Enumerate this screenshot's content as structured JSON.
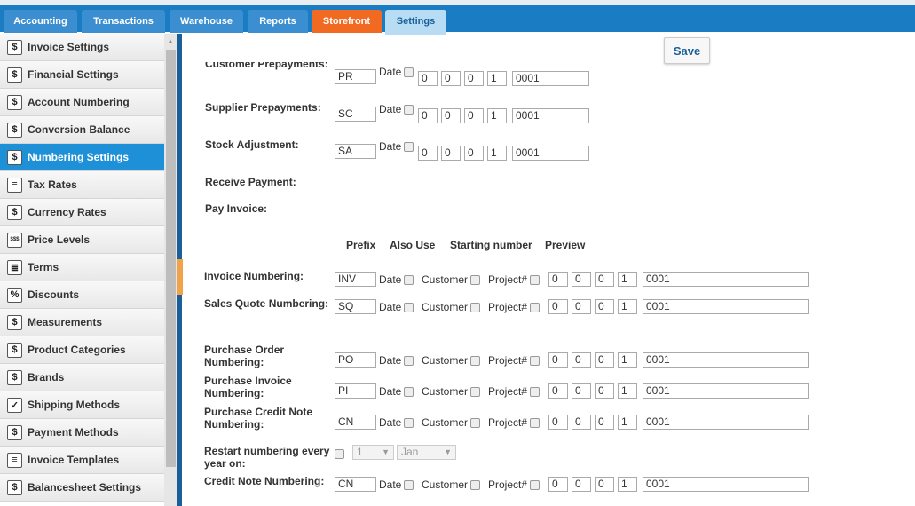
{
  "tabs": [
    "Accounting",
    "Transactions",
    "Warehouse",
    "Reports",
    "Storefront",
    "Settings"
  ],
  "sidebar": {
    "items": [
      {
        "label": "Invoice Settings",
        "icon": "$"
      },
      {
        "label": "Financial Settings",
        "icon": "$"
      },
      {
        "label": "Account Numbering",
        "icon": "$"
      },
      {
        "label": "Conversion Balance",
        "icon": "$"
      },
      {
        "label": "Numbering Settings",
        "icon": "$"
      },
      {
        "label": "Tax Rates",
        "icon": "≡"
      },
      {
        "label": "Currency Rates",
        "icon": "$"
      },
      {
        "label": "Price Levels",
        "icon": "$$$"
      },
      {
        "label": "Terms",
        "icon": "≣"
      },
      {
        "label": "Discounts",
        "icon": "%"
      },
      {
        "label": "Measurements",
        "icon": "$"
      },
      {
        "label": "Product Categories",
        "icon": "$"
      },
      {
        "label": "Brands",
        "icon": "$"
      },
      {
        "label": "Shipping Methods",
        "icon": "✓"
      },
      {
        "label": "Payment Methods",
        "icon": "$"
      },
      {
        "label": "Invoice Templates",
        "icon": "≡"
      },
      {
        "label": "Balancesheet Settings",
        "icon": "$"
      }
    ]
  },
  "save_label": "Save",
  "prepay_rows": [
    {
      "label": "Customer Prepayments:",
      "prefix": "PR",
      "date_label": "Date",
      "d": [
        "0",
        "0",
        "0",
        "1"
      ],
      "preview": "0001"
    },
    {
      "label": "Supplier Prepayments:",
      "prefix": "SC",
      "date_label": "Date",
      "d": [
        "0",
        "0",
        "0",
        "1"
      ],
      "preview": "0001"
    },
    {
      "label": "Stock Adjustment:",
      "prefix": "SA",
      "date_label": "Date",
      "d": [
        "0",
        "0",
        "0",
        "1"
      ],
      "preview": "0001"
    }
  ],
  "receive_payment": "Receive Payment:",
  "pay_invoice": "Pay Invoice:",
  "headers": {
    "prefix": "Prefix",
    "also_use": "Also Use",
    "starting": "Starting number",
    "preview": "Preview"
  },
  "num_rows": [
    {
      "label": "Invoice Numbering:",
      "prefix": "INV",
      "d": [
        "0",
        "0",
        "0",
        "1"
      ],
      "preview": "0001"
    },
    {
      "label": "Sales Quote Numbering:",
      "prefix": "SQ",
      "d": [
        "0",
        "0",
        "0",
        "1"
      ],
      "preview": "0001"
    },
    {
      "label": "Purchase Order Numbering:",
      "prefix": "PO",
      "d": [
        "0",
        "0",
        "0",
        "1"
      ],
      "preview": "0001"
    },
    {
      "label": "Purchase Invoice Numbering:",
      "prefix": "PI",
      "d": [
        "0",
        "0",
        "0",
        "1"
      ],
      "preview": "0001"
    },
    {
      "label": "Purchase Credit Note Numbering:",
      "prefix": "CN",
      "d": [
        "0",
        "0",
        "0",
        "1"
      ],
      "preview": "0001"
    },
    {
      "label": "Credit Note Numbering:",
      "prefix": "CN",
      "d": [
        "0",
        "0",
        "0",
        "1"
      ],
      "preview": "0001"
    }
  ],
  "opt_labels": {
    "date": "Date",
    "customer": "Customer",
    "project": "Project#"
  },
  "restart": {
    "label": "Restart numbering every year on:",
    "day": "1",
    "month": "Jan"
  }
}
